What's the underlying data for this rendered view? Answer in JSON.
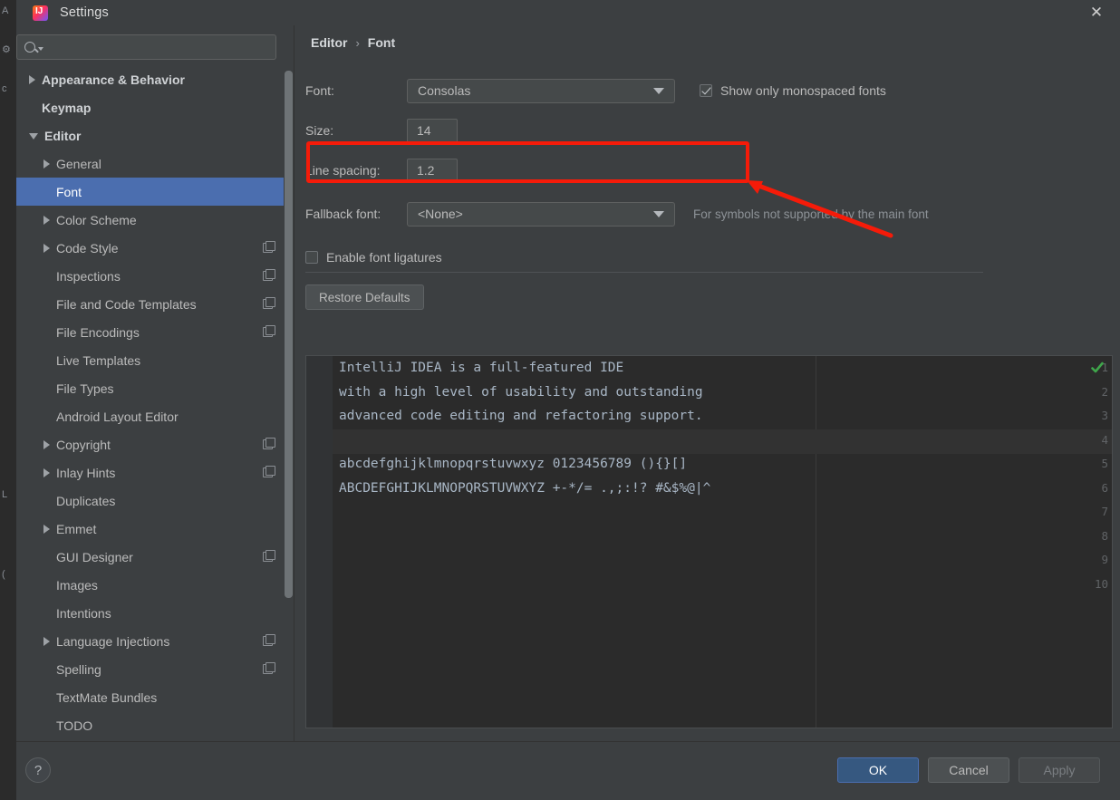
{
  "window": {
    "title": "Settings",
    "app_icon": "intellij-idea-icon",
    "close_icon": "close-icon"
  },
  "sidebar": {
    "search": {
      "value": "",
      "placeholder": "",
      "icon": "search-icon",
      "caret_icon": "chevron-down-icon"
    },
    "items": [
      {
        "label": "Appearance & Behavior",
        "arrow": "right",
        "bold": true,
        "copy": false,
        "selected": false
      },
      {
        "label": "Keymap",
        "arrow": "none",
        "bold": true,
        "copy": false,
        "selected": false
      },
      {
        "label": "Editor",
        "arrow": "down",
        "bold": true,
        "copy": false,
        "selected": false
      },
      {
        "label": "General",
        "arrow": "right",
        "bold": false,
        "copy": false,
        "selected": false,
        "indent": 1
      },
      {
        "label": "Font",
        "arrow": "none",
        "bold": false,
        "copy": false,
        "selected": true,
        "indent": 1
      },
      {
        "label": "Color Scheme",
        "arrow": "right",
        "bold": false,
        "copy": false,
        "selected": false,
        "indent": 1
      },
      {
        "label": "Code Style",
        "arrow": "right",
        "bold": false,
        "copy": true,
        "selected": false,
        "indent": 1
      },
      {
        "label": "Inspections",
        "arrow": "none",
        "bold": false,
        "copy": true,
        "selected": false,
        "indent": 1
      },
      {
        "label": "File and Code Templates",
        "arrow": "none",
        "bold": false,
        "copy": true,
        "selected": false,
        "indent": 1
      },
      {
        "label": "File Encodings",
        "arrow": "none",
        "bold": false,
        "copy": true,
        "selected": false,
        "indent": 1
      },
      {
        "label": "Live Templates",
        "arrow": "none",
        "bold": false,
        "copy": false,
        "selected": false,
        "indent": 1
      },
      {
        "label": "File Types",
        "arrow": "none",
        "bold": false,
        "copy": false,
        "selected": false,
        "indent": 1
      },
      {
        "label": "Android Layout Editor",
        "arrow": "none",
        "bold": false,
        "copy": false,
        "selected": false,
        "indent": 1
      },
      {
        "label": "Copyright",
        "arrow": "right",
        "bold": false,
        "copy": true,
        "selected": false,
        "indent": 1
      },
      {
        "label": "Inlay Hints",
        "arrow": "right",
        "bold": false,
        "copy": true,
        "selected": false,
        "indent": 1
      },
      {
        "label": "Duplicates",
        "arrow": "none",
        "bold": false,
        "copy": false,
        "selected": false,
        "indent": 1
      },
      {
        "label": "Emmet",
        "arrow": "right",
        "bold": false,
        "copy": false,
        "selected": false,
        "indent": 1
      },
      {
        "label": "GUI Designer",
        "arrow": "none",
        "bold": false,
        "copy": true,
        "selected": false,
        "indent": 1
      },
      {
        "label": "Images",
        "arrow": "none",
        "bold": false,
        "copy": false,
        "selected": false,
        "indent": 1
      },
      {
        "label": "Intentions",
        "arrow": "none",
        "bold": false,
        "copy": false,
        "selected": false,
        "indent": 1
      },
      {
        "label": "Language Injections",
        "arrow": "right",
        "bold": false,
        "copy": true,
        "selected": false,
        "indent": 1
      },
      {
        "label": "Spelling",
        "arrow": "none",
        "bold": false,
        "copy": true,
        "selected": false,
        "indent": 1
      },
      {
        "label": "TextMate Bundles",
        "arrow": "none",
        "bold": false,
        "copy": false,
        "selected": false,
        "indent": 1
      },
      {
        "label": "TODO",
        "arrow": "none",
        "bold": false,
        "copy": false,
        "selected": false,
        "indent": 1
      }
    ]
  },
  "breadcrumb": {
    "parent": "Editor",
    "separator": "›",
    "current": "Font"
  },
  "form": {
    "font_label": "Font:",
    "font_value": "Consolas",
    "monospaced_label": "Show only monospaced fonts",
    "monospaced_checked": true,
    "size_label": "Size:",
    "size_value": "14",
    "line_spacing_label": "Line spacing:",
    "line_spacing_value": "1.2",
    "fallback_label": "Fallback font:",
    "fallback_value": "<None>",
    "fallback_hint": "For symbols not supported by the main font",
    "ligatures_label": "Enable font ligatures",
    "ligatures_checked": false,
    "restore_defaults": "Restore Defaults"
  },
  "preview": {
    "line_numbers": [
      "1",
      "2",
      "3",
      "4",
      "5",
      "6",
      "7",
      "8",
      "9",
      "10"
    ],
    "lines": [
      "IntelliJ IDEA is a full-featured IDE",
      "with a high level of usability and outstanding",
      "advanced code editing and refactoring support.",
      "",
      "abcdefghijklmnopqrstuvwxyz 0123456789 (){}[]",
      "ABCDEFGHIJKLMNOPQRSTUVWXYZ +-*/= .,;:!? #&$%@|^",
      "",
      "",
      "",
      ""
    ],
    "status_icon": "green-checkmark-icon"
  },
  "annotation": {
    "highlight_color": "#f51b09",
    "box_target": "size-field-row",
    "arrow": "pointer-arrow"
  },
  "footer": {
    "help_label": "?",
    "ok_label": "OK",
    "cancel_label": "Cancel",
    "apply_label": "Apply",
    "apply_enabled": false
  }
}
